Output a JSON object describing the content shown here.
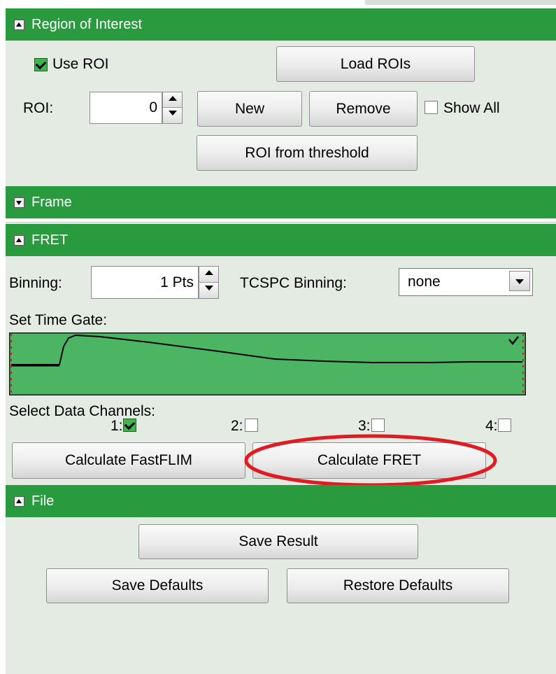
{
  "roi_section": {
    "title": "Region of Interest",
    "use_roi_label": "Use ROI",
    "use_roi_checked": true,
    "load_rois_label": "Load ROIs",
    "roi_label": "ROI:",
    "roi_value": "0",
    "new_label": "New",
    "remove_label": "Remove",
    "show_all_label": "Show All",
    "show_all_checked": false,
    "roi_threshold_label": "ROI from threshold"
  },
  "frame_section": {
    "title": "Frame"
  },
  "fret_section": {
    "title": "FRET",
    "binning_label": "Binning:",
    "binning_value": "1 Pts",
    "tcspc_label": "TCSPC Binning:",
    "tcspc_value": "none",
    "time_gate_label": "Set Time Gate:",
    "select_channels_label": "Select Data Channels:",
    "channels": [
      {
        "label": "1:",
        "checked": true
      },
      {
        "label": "2:",
        "checked": false
      },
      {
        "label": "3:",
        "checked": false
      },
      {
        "label": "4:",
        "checked": false
      }
    ],
    "calc_fastflim_label": "Calculate FastFLIM",
    "calc_fret_label": "Calculate FRET"
  },
  "file_section": {
    "title": "File",
    "save_result_label": "Save Result",
    "save_defaults_label": "Save Defaults",
    "restore_defaults_label": "Restore Defaults"
  },
  "colors": {
    "header_green": "#2a9a3e",
    "panel_bg": "#e3ebe3",
    "gate_fill": "#4cb563",
    "gate_cursor": "#e0151b",
    "highlight_ring": "#e11b22"
  }
}
